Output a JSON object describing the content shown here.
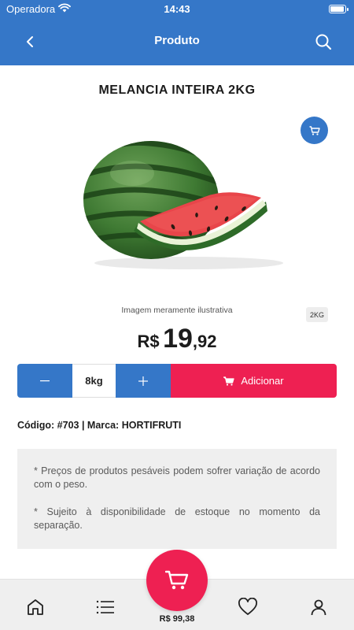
{
  "status_bar": {
    "carrier": "Operadora",
    "time": "14:43"
  },
  "nav": {
    "title": "Produto",
    "back_icon": "chevron-left-icon",
    "search_icon": "search-icon"
  },
  "product": {
    "title": "MELANCIA INTEIRA 2KG",
    "image_caption": "Imagem meramente ilustrativa",
    "weight_badge": "2KG",
    "price": {
      "currency": "R$",
      "integer": "19",
      "decimal": ",92"
    },
    "code_brand": "Código: #703 | Marca: HORTIFRUTI"
  },
  "quantity": {
    "minus_label": "−",
    "value": "8kg",
    "plus_label": "+"
  },
  "add_button": {
    "label": "Adicionar"
  },
  "notes": [
    "* Preços de produtos pesáveis podem sofrer variação de acordo com o peso.",
    "* Sujeito à disponibilidade de estoque no momento da separação."
  ],
  "tabbar": {
    "items": [
      "home-icon",
      "list-icon",
      "heart-icon",
      "user-icon"
    ],
    "cart_total": "R$ 99,38"
  },
  "colors": {
    "primary": "#3577c8",
    "accent": "#ee2052",
    "notes_bg": "#efefef"
  }
}
